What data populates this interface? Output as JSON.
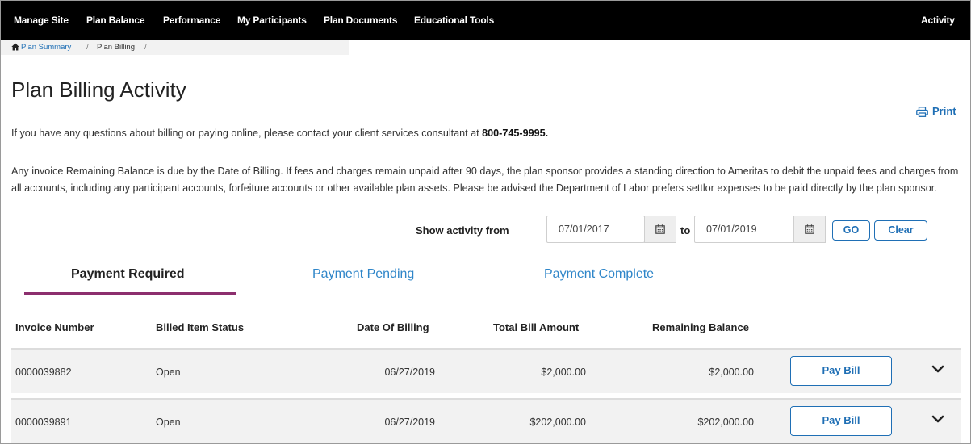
{
  "nav": {
    "items": [
      "Manage Site",
      "Plan Balance",
      "Performance",
      "My Participants",
      "Plan Documents",
      "Educational Tools"
    ],
    "right": "Activity"
  },
  "breadcrumb": {
    "home": "Plan Summary",
    "sep": "/",
    "current": "Plan Billing"
  },
  "page": {
    "title": "Plan Billing Activity",
    "print_label": "Print",
    "contact_text": "If you have any questions about billing or paying online, please contact your client services consultant at ",
    "phone": "800-745-9995.",
    "policy_text": "Any invoice Remaining Balance is due by the Date of Billing. If fees and charges remain unpaid after 90 days, the plan sponsor provides a standing direction to Ameritas to debit the unpaid fees and charges from all accounts, including any participant accounts, forfeiture accounts or other available plan assets. Please be advised the Department of Labor prefers settlor expenses to be paid directly by the plan sponsor."
  },
  "filter": {
    "label": "Show activity from",
    "from": "07/01/2017",
    "to_label": "to",
    "to": "07/01/2019",
    "go": "GO",
    "clear": "Clear"
  },
  "tabs": [
    {
      "label": "Payment Required",
      "active": true
    },
    {
      "label": "Payment Pending",
      "active": false
    },
    {
      "label": "Payment Complete",
      "active": false
    }
  ],
  "table": {
    "headers": [
      "Invoice Number",
      "Billed Item Status",
      "Date Of Billing",
      "Total Bill Amount",
      "Remaining Balance"
    ],
    "rows": [
      {
        "invoice": "0000039882",
        "status": "Open",
        "date": "06/27/2019",
        "total": "$2,000.00",
        "remaining": "$2,000.00",
        "action": "Pay Bill"
      },
      {
        "invoice": "0000039891",
        "status": "Open",
        "date": "06/27/2019",
        "total": "$202,000.00",
        "remaining": "$202,000.00",
        "action": "Pay Bill"
      }
    ]
  },
  "colors": {
    "nav_bg": "#000000",
    "link": "#1f6fb5",
    "tab_accent": "#8c2f6e",
    "row_bg": "#f2f2f2"
  },
  "icons": [
    "home-icon",
    "printer-icon",
    "calendar-icon",
    "chevron-down-icon"
  ]
}
